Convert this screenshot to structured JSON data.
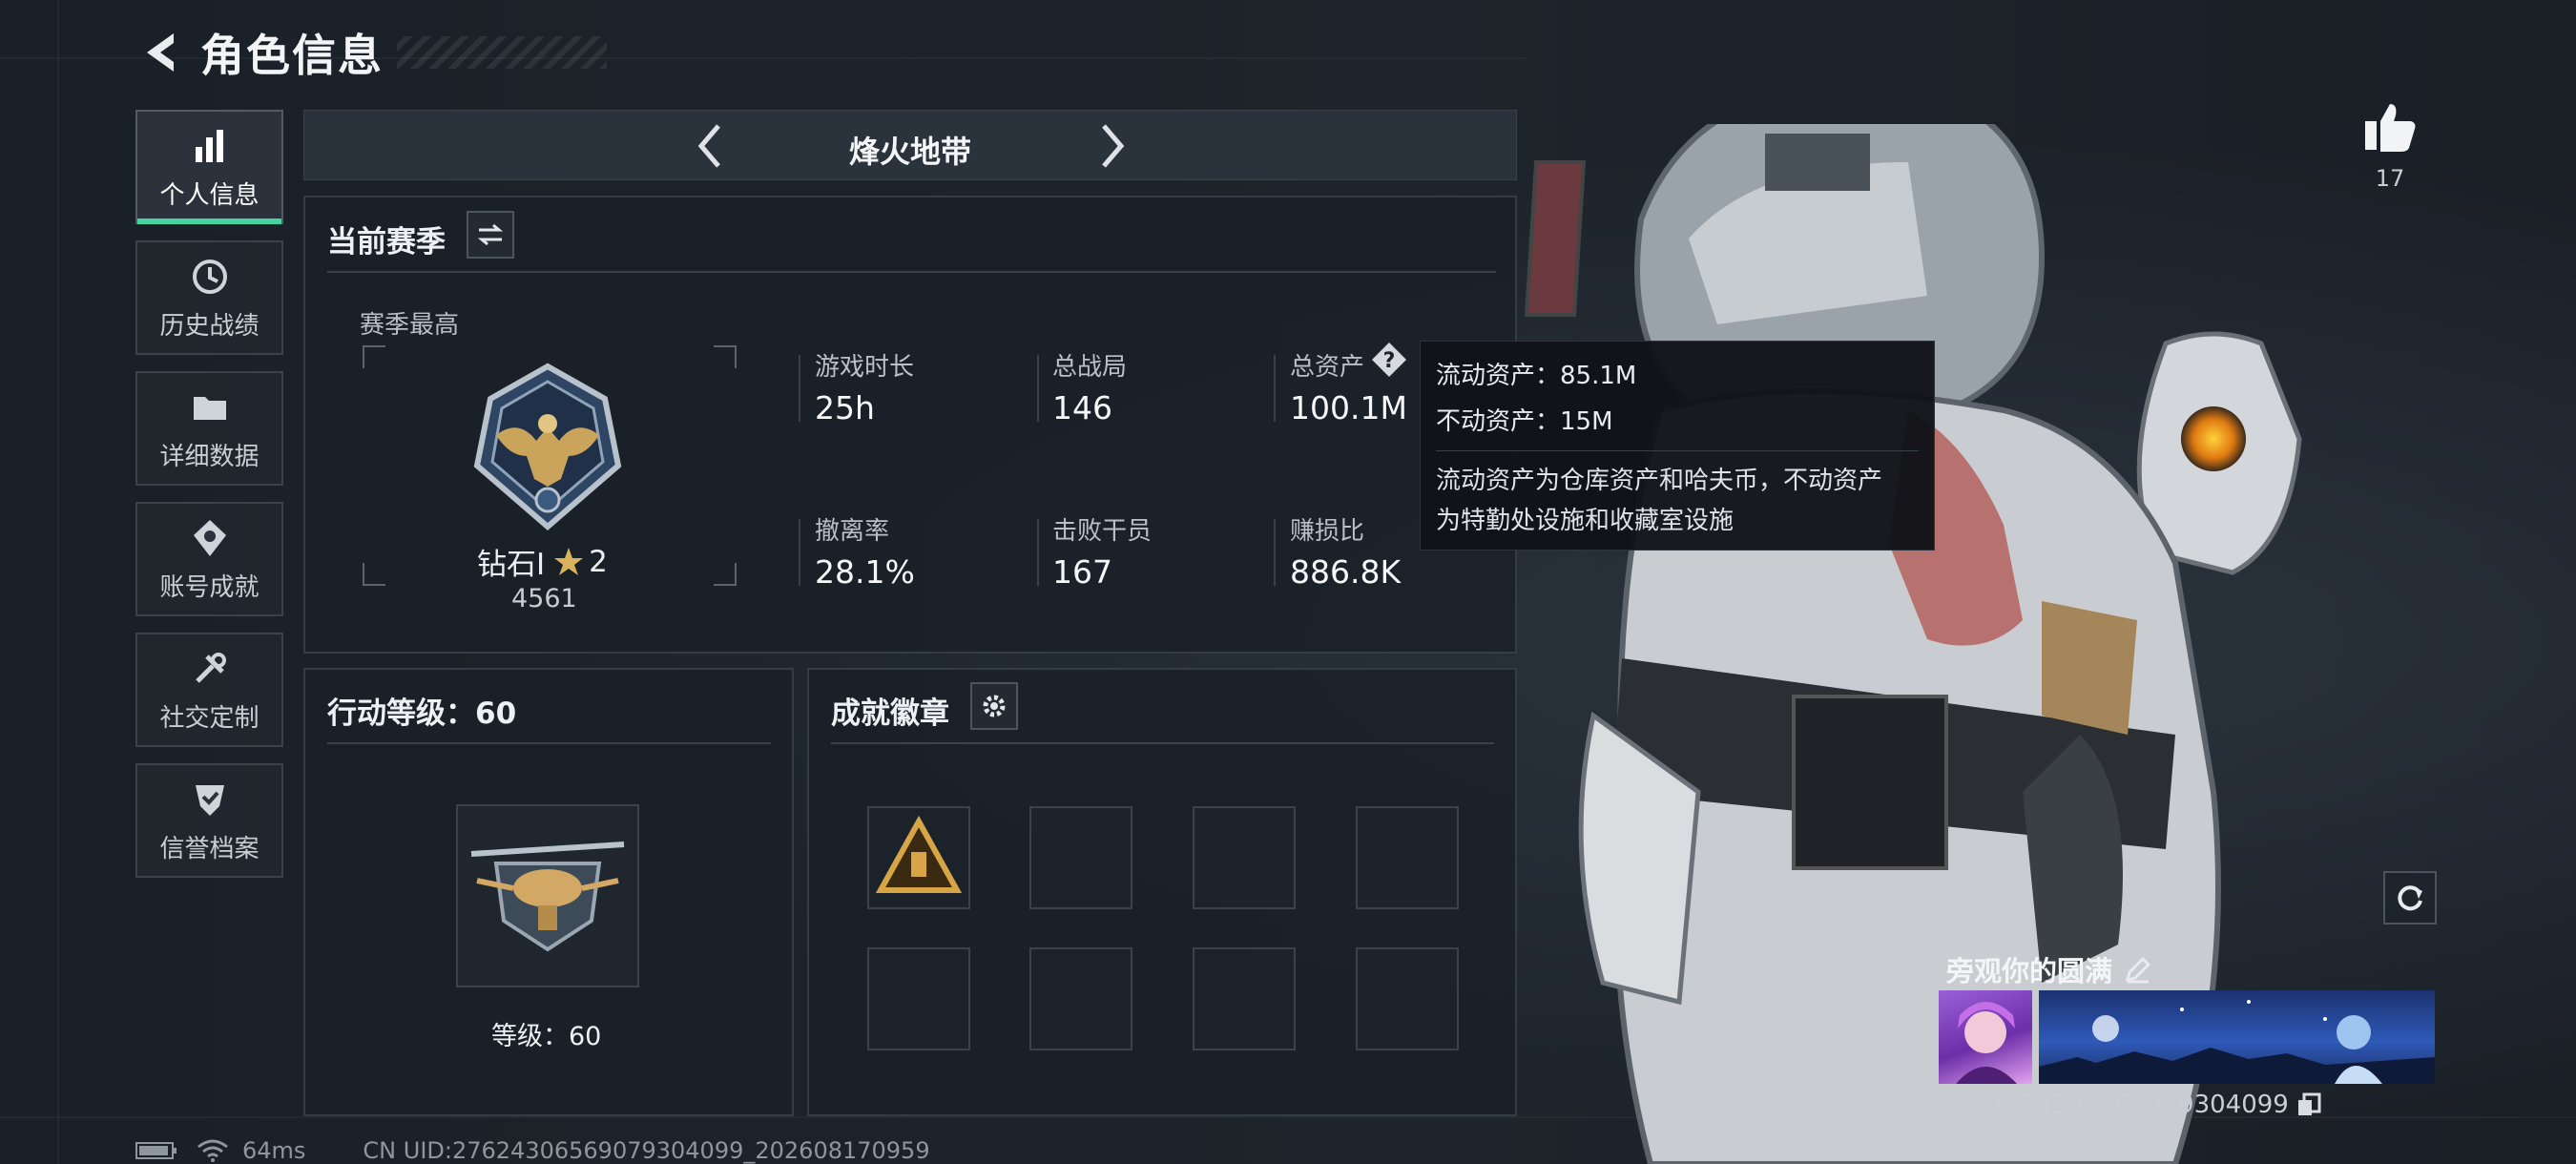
{
  "header": {
    "title": "角色信息"
  },
  "nav": {
    "items": [
      {
        "label": "个人信息",
        "icon": "bar-chart-icon",
        "active": true
      },
      {
        "label": "历史战绩",
        "icon": "history-clock-icon",
        "active": false
      },
      {
        "label": "详细数据",
        "icon": "folder-icon",
        "active": false
      },
      {
        "label": "账号成就",
        "icon": "achievement-icon",
        "active": false
      },
      {
        "label": "社交定制",
        "icon": "wrench-icon",
        "active": false
      },
      {
        "label": "信誉档案",
        "icon": "shield-check-icon",
        "active": false
      }
    ]
  },
  "mode": {
    "name": "烽火地带"
  },
  "season": {
    "title": "当前赛季",
    "best_label": "赛季最高",
    "rank_name": "钻石I",
    "rank_stars": "2",
    "rank_score": "4561",
    "stats": {
      "play_time_label": "游戏时长",
      "play_time": "25h",
      "total_matches_label": "总战局",
      "total_matches": "146",
      "total_assets_label": "总资产",
      "total_assets": "100.1M",
      "extract_rate_label": "撤离率",
      "extract_rate": "28.1%",
      "kills_label": "击败干员",
      "kills": "167",
      "profit_ratio_label": "赚损比",
      "profit_ratio": "886.8K"
    }
  },
  "tooltip": {
    "liquid": "流动资产：85.1M",
    "fixed": "不动资产：15M",
    "desc_line1": "流动资产为仓库资产和哈夫币，不动资产",
    "desc_line2": "为特勤处设施和收藏室设施"
  },
  "action_level": {
    "title": "行动等级：60",
    "level_text": "等级：60"
  },
  "badges": {
    "title": "成就徽章",
    "slots_total": 8,
    "filled": 1
  },
  "like": {
    "count": "17"
  },
  "card": {
    "title": "旁观你的圆满",
    "uid": "27624306569079304099"
  },
  "status": {
    "ping": "64ms",
    "uid_line": "CN UID:27624306569079304099_202608170959"
  },
  "colors": {
    "accent": "#45d3a0",
    "tooltip_bg": "#101317",
    "panel_border": "#343d46"
  }
}
